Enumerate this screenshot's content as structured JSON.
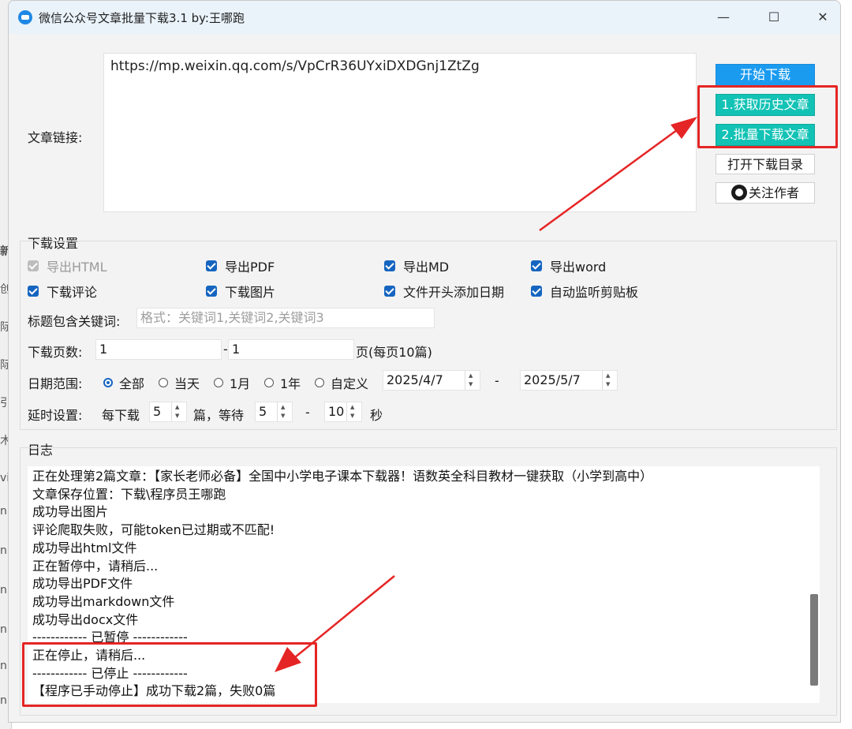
{
  "window": {
    "title": "微信公众号文章批量下载3.1 by:王哪跑",
    "minimize": "—",
    "maximize": "☐",
    "close": "✕"
  },
  "url": {
    "label": "文章链接:",
    "value": "https://mp.weixin.qq.com/s/VpCrR36UYxiDXDGnj1ZtZg"
  },
  "buttons": {
    "start": "开始下载",
    "get_history": "1.获取历史文章",
    "batch_download": "2.批量下载文章",
    "open_dir": "打开下载目录",
    "follow": "关注作者"
  },
  "settings": {
    "title": "下载设置",
    "options": [
      {
        "label": "导出HTML",
        "checked": true,
        "disabled": true
      },
      {
        "label": "导出PDF",
        "checked": true
      },
      {
        "label": "导出MD",
        "checked": true
      },
      {
        "label": "导出word",
        "checked": true
      },
      {
        "label": "下载评论",
        "checked": true
      },
      {
        "label": "下载图片",
        "checked": true
      },
      {
        "label": "文件开头添加日期",
        "checked": true
      },
      {
        "label": "自动监听剪贴板",
        "checked": true
      }
    ],
    "keyword_label": "标题包含关键词:",
    "keyword_placeholder": "格式：关键词1,关键词2,关键词3",
    "pages_label": "下载页数:",
    "page_from": "1",
    "page_sep": "-",
    "page_to": "1",
    "pages_suffix": "页(每页10篇)",
    "date_label": "日期范围:",
    "date_options": [
      {
        "label": "全部",
        "selected": true
      },
      {
        "label": "当天",
        "selected": false
      },
      {
        "label": "1月",
        "selected": false
      },
      {
        "label": "1年",
        "selected": false
      },
      {
        "label": "自定义",
        "selected": false
      }
    ],
    "date_from": "2025/4/7",
    "date_sep": "-",
    "date_to": "2025/5/7",
    "delay_label": "延时设置:",
    "delay_every": "每下载",
    "delay_count": "5",
    "delay_unit": "篇，等待",
    "delay_min": "5",
    "delay_sep": "-",
    "delay_max": "10",
    "delay_seconds": "秒"
  },
  "log": {
    "title": "日志",
    "lines": [
      "正在处理第2篇文章：【家长老师必备】全国中小学电子课本下载器！语数英全科目教材一键获取（小学到高中）",
      "文章保存位置：下载\\程序员王哪跑",
      "成功导出图片",
      "评论爬取失败，可能token已过期或不匹配!",
      "成功导出html文件",
      "正在暂停中，请稍后...",
      "成功导出PDF文件",
      "成功导出markdown文件",
      "成功导出docx文件",
      "------------ 已暂停 ------------",
      "正在停止，请稍后...",
      "------------ 已停止 ------------",
      "【程序已手动停止】成功下载2篇，失败0篇"
    ]
  },
  "background_window_fragments": [
    "新",
    "创",
    "际",
    "际",
    "引",
    "木",
    "vi",
    "n",
    "n",
    "n",
    "n",
    "n",
    "n",
    "n"
  ],
  "colors": {
    "accent_blue": "#1a9bf0",
    "accent_teal": "#12c2b5",
    "annotation_red": "#e52525",
    "checkbox": "#1565c0"
  }
}
